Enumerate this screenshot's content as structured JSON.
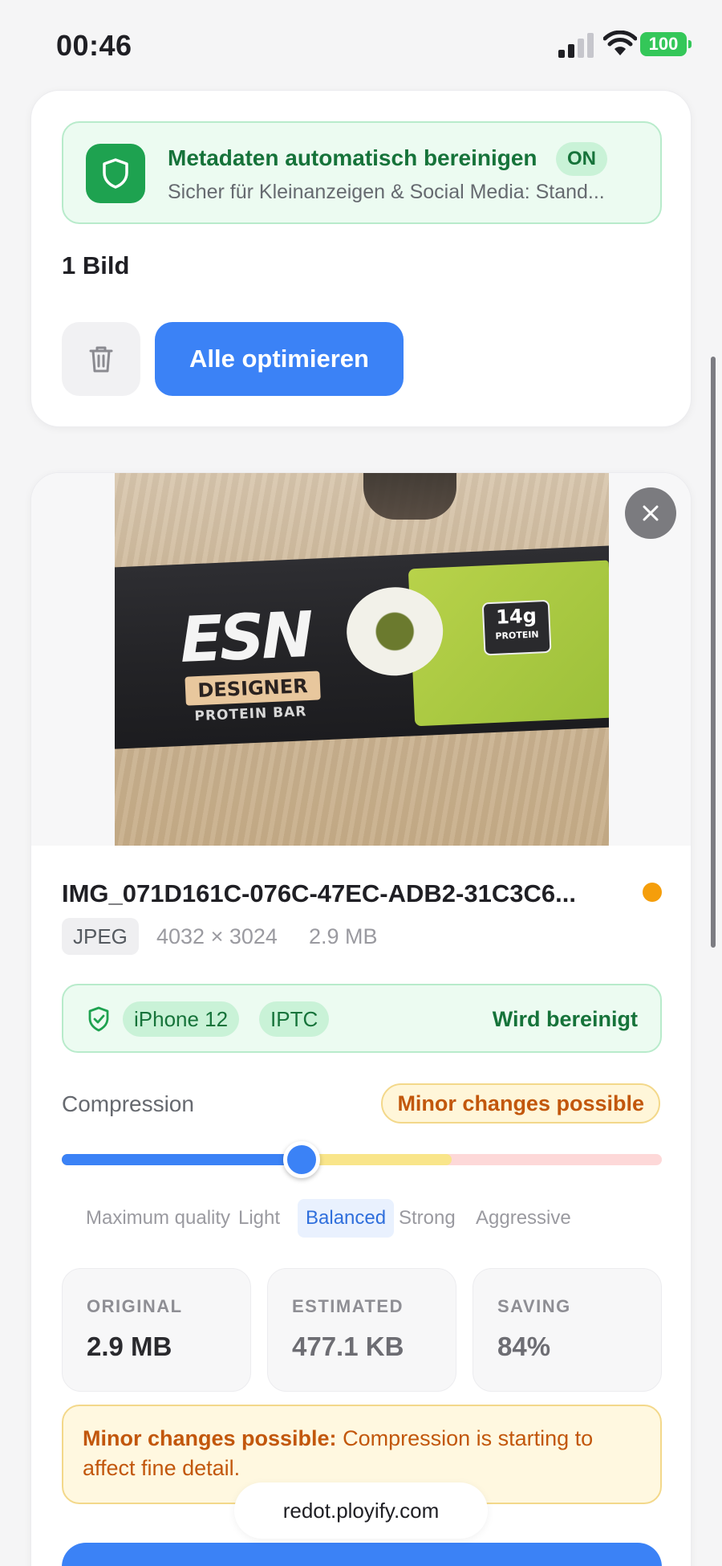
{
  "status_bar": {
    "time": "00:46",
    "battery": "100"
  },
  "privacy": {
    "title": "Metadaten automatisch bereinigen",
    "badge": "ON",
    "subtitle": "Sicher für Kleinanzeigen & Social Media: Stand..."
  },
  "queue": {
    "count_label": "1 Bild",
    "optimize_all_label": "Alle optimieren"
  },
  "image": {
    "filename": "IMG_071D161C-076C-47EC-ADB2-31C3C6...",
    "format": "JPEG",
    "dimensions": "4032 × 3024",
    "size": "2.9 MB",
    "photo_brand": "ESN",
    "photo_designer": "DESIGNER",
    "photo_product": "PROTEIN BAR",
    "photo_protein": "14g",
    "photo_protein_unit": "PROTEIN",
    "metadata": {
      "device": "iPhone 12",
      "tag": "IPTC",
      "status": "Wird bereinigt"
    }
  },
  "compression": {
    "label": "Compression",
    "warning_badge": "Minor changes possible",
    "level_fraction": 0.4,
    "levels": [
      "Maximum quality",
      "Light",
      "Balanced",
      "Strong",
      "Aggressive"
    ],
    "selected_level": "Balanced"
  },
  "stats": {
    "original_label": "ORIGINAL",
    "original_value": "2.9 MB",
    "estimated_label": "ESTIMATED",
    "estimated_value": "477.1 KB",
    "saving_label": "SAVING",
    "saving_value": "84%"
  },
  "notice": {
    "title": "Minor changes possible:",
    "text": "Compression is starting to affect fine detail."
  },
  "browser": {
    "url": "redot.ployify.com"
  },
  "colors": {
    "accent": "#3b82f6",
    "success": "#16733a",
    "warning": "#c2570c",
    "status_dot": "#f59e0b"
  }
}
